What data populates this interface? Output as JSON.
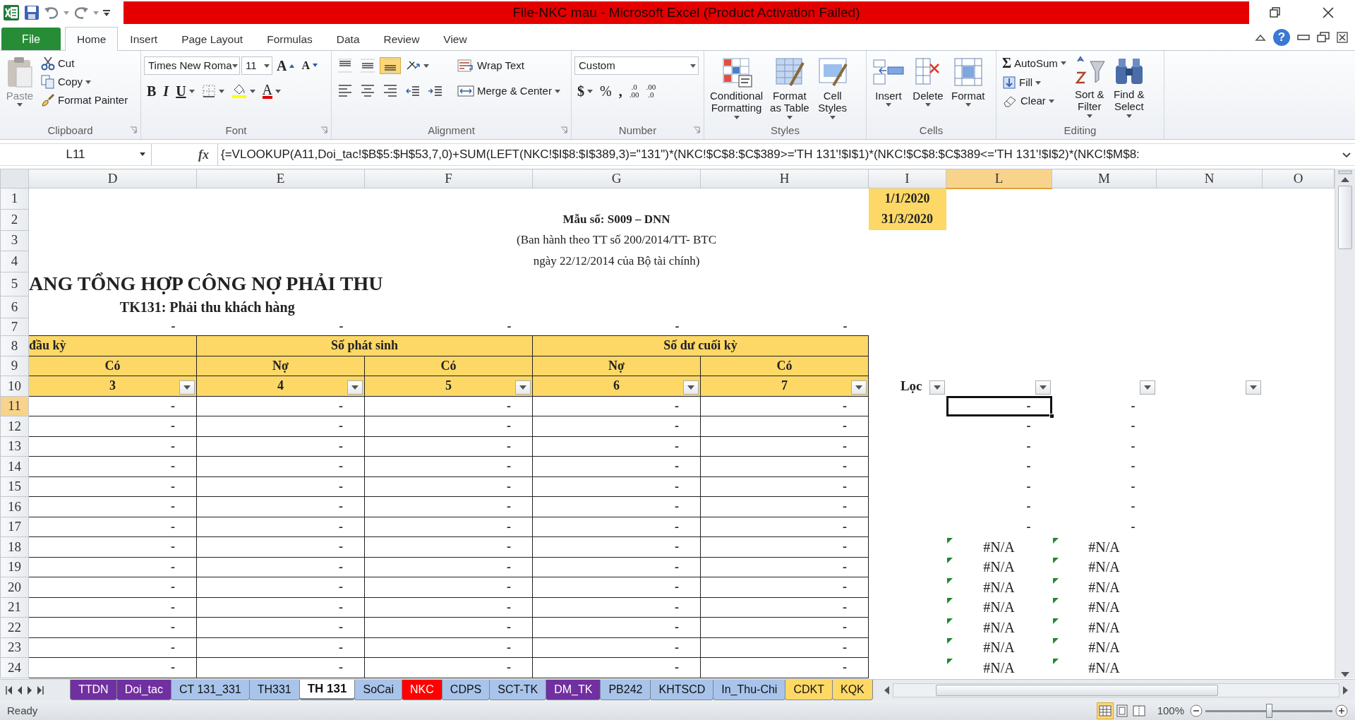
{
  "window": {
    "title": "File-NKC mau  -  Microsoft Excel (Product Activation Failed)",
    "help": "?"
  },
  "menu_tabs": [
    {
      "label": "File",
      "kind": "file",
      "selected": false
    },
    {
      "label": "Home",
      "kind": "tab",
      "selected": true
    },
    {
      "label": "Insert",
      "kind": "tab",
      "selected": false
    },
    {
      "label": "Page Layout",
      "kind": "tab",
      "selected": false
    },
    {
      "label": "Formulas",
      "kind": "tab",
      "selected": false
    },
    {
      "label": "Data",
      "kind": "tab",
      "selected": false
    },
    {
      "label": "Review",
      "kind": "tab",
      "selected": false
    },
    {
      "label": "View",
      "kind": "tab",
      "selected": false
    }
  ],
  "ribbon": {
    "clipboard": {
      "caption": "Clipboard",
      "paste": "Paste",
      "cut": "Cut",
      "copy": "Copy",
      "format_painter": "Format Painter"
    },
    "font": {
      "caption": "Font",
      "font_name": "Times New Roma",
      "font_size": "11",
      "grow": "A",
      "shrink": "A",
      "bold": "B",
      "italic": "I",
      "underline": "U",
      "font_color": "A"
    },
    "alignment": {
      "caption": "Alignment",
      "vertical": [
        {
          "selected": false
        },
        {
          "selected": false
        },
        {
          "selected": true
        }
      ],
      "wrap_text": "Wrap Text",
      "merge_center": "Merge & Center"
    },
    "number": {
      "caption": "Number",
      "format": "Custom",
      "currency": "$",
      "percent": "%",
      "comma": ",",
      "increase_decimal": [
        ".0",
        ".00"
      ],
      "decrease_decimal": [
        ".00",
        ".0"
      ]
    },
    "styles": {
      "caption": "Styles",
      "buttons": [
        {
          "lines": [
            "Conditional",
            "Formatting"
          ]
        },
        {
          "lines": [
            "Format",
            "as Table"
          ]
        },
        {
          "lines": [
            "Cell",
            "Styles"
          ]
        }
      ]
    },
    "cells": {
      "caption": "Cells",
      "buttons": [
        {
          "label": "Insert"
        },
        {
          "label": "Delete"
        },
        {
          "label": "Format"
        }
      ]
    },
    "editing": {
      "caption": "Editing",
      "sigma": "Σ",
      "autosum": "AutoSum",
      "fill": "Fill",
      "clear": "Clear",
      "buttons": [
        {
          "lines": [
            "Sort &",
            "Filter"
          ]
        },
        {
          "lines": [
            "Find &",
            "Select"
          ]
        }
      ]
    }
  },
  "formula_bar": {
    "name_box": "L11",
    "fx": "fx",
    "formula": "{=VLOOKUP(A11,Doi_tac!$B$5:$H$53,7,0)+SUM(LEFT(NKC!$I$8:$I$389,3)=\"131\")*(NKC!$C$8:$C$389>='TH 131'!$I$1)*(NKC!$C$8:$C$389<='TH 131'!$I$2)*(NKC!$M$8:"
  },
  "columns": [
    {
      "label": "D",
      "selected": false
    },
    {
      "label": "E",
      "selected": false
    },
    {
      "label": "F",
      "selected": false
    },
    {
      "label": "G",
      "selected": false
    },
    {
      "label": "H",
      "selected": false
    },
    {
      "label": "I",
      "selected": false
    },
    {
      "label": "L",
      "selected": true
    },
    {
      "label": "M",
      "selected": false
    },
    {
      "label": "N",
      "selected": false
    },
    {
      "label": "O",
      "selected": false
    }
  ],
  "rows": [
    {
      "label": "1",
      "selected": false,
      "cells": [
        {
          "kind": "blank"
        },
        {
          "kind": "blank"
        },
        {
          "kind": "blank"
        },
        {
          "kind": "blank"
        },
        {
          "kind": "blank"
        },
        {
          "kind": "date",
          "text": "1/1/2020"
        }
      ]
    },
    {
      "label": "2",
      "selected": false,
      "cells": [
        {
          "kind": "blank"
        },
        {
          "kind": "blank"
        },
        {
          "kind": "form_code",
          "text": "Mẫu số: S009 – DNN"
        },
        {
          "kind": "merged"
        },
        {
          "kind": "merged"
        },
        {
          "kind": "date",
          "text": "31/3/2020"
        }
      ]
    },
    {
      "label": "3",
      "selected": false,
      "cells": [
        {
          "kind": "blank"
        },
        {
          "kind": "blank"
        },
        {
          "kind": "note",
          "text": "(Ban hành theo TT số 200/2014/TT- BTC"
        },
        {
          "kind": "merged"
        },
        {
          "kind": "merged"
        }
      ]
    },
    {
      "label": "4",
      "selected": false,
      "cells": [
        {
          "kind": "blank"
        },
        {
          "kind": "blank"
        },
        {
          "kind": "note",
          "text": "ngày 22/12/2014 của Bộ tài chính)"
        },
        {
          "kind": "merged"
        },
        {
          "kind": "merged"
        }
      ]
    },
    {
      "label": "5",
      "selected": false,
      "cells": [
        {
          "kind": "title",
          "text": "ANG TỔNG HỢP CÔNG NỢ PHẢI THU"
        },
        {
          "kind": "merged"
        }
      ]
    },
    {
      "label": "6",
      "selected": false,
      "cells": [
        {
          "kind": "subtitle",
          "text": "TK131: Phải thu khách hàng"
        },
        {
          "kind": "merged"
        }
      ]
    },
    {
      "label": "7",
      "selected": false,
      "cells": [
        {
          "kind": "dash",
          "text": "-"
        },
        {
          "kind": "dash",
          "text": "-"
        },
        {
          "kind": "dash",
          "text": "-"
        },
        {
          "kind": "dash",
          "text": "-"
        },
        {
          "kind": "dash",
          "text": "-"
        }
      ]
    },
    {
      "label": "8",
      "selected": false,
      "cells": [
        {
          "kind": "header_cut",
          "text": "đầu kỳ"
        },
        {
          "kind": "header",
          "text": "Số phát sinh"
        },
        {
          "kind": "merged"
        },
        {
          "kind": "header",
          "text": "Số dư cuối kỳ"
        },
        {
          "kind": "merged"
        }
      ]
    },
    {
      "label": "9",
      "selected": false,
      "cells": [
        {
          "kind": "header",
          "text": "Có"
        },
        {
          "kind": "header",
          "text": "Nợ"
        },
        {
          "kind": "header",
          "text": "Có"
        },
        {
          "kind": "header",
          "text": "Nợ"
        },
        {
          "kind": "header",
          "text": "Có"
        }
      ]
    },
    {
      "label": "10",
      "selected": false,
      "cells": [
        {
          "kind": "header",
          "text": "3",
          "filter": true
        },
        {
          "kind": "header",
          "text": "4",
          "filter": true
        },
        {
          "kind": "header",
          "text": "5",
          "filter": true
        },
        {
          "kind": "header",
          "text": "6",
          "filter": true
        },
        {
          "kind": "header",
          "text": "7",
          "filter": true
        },
        {
          "kind": "filter_label",
          "text": "Lọc",
          "filter": true
        },
        {
          "kind": "blank",
          "filter": true
        },
        {
          "kind": "blank",
          "filter": true
        },
        {
          "kind": "blank",
          "filter": true
        }
      ]
    },
    {
      "label": "11",
      "selected": true,
      "cells": [
        {
          "kind": "value",
          "text": "-"
        },
        {
          "kind": "value",
          "text": "-"
        },
        {
          "kind": "value",
          "text": "-"
        },
        {
          "kind": "value",
          "text": "-"
        },
        {
          "kind": "value",
          "text": "-"
        },
        {
          "kind": "blank"
        },
        {
          "kind": "dash",
          "text": "-",
          "selected": true
        },
        {
          "kind": "dash",
          "text": "-"
        }
      ]
    },
    {
      "label": "12",
      "selected": false,
      "cells": [
        {
          "kind": "value",
          "text": "-"
        },
        {
          "kind": "value",
          "text": "-"
        },
        {
          "kind": "value",
          "text": "-"
        },
        {
          "kind": "value",
          "text": "-"
        },
        {
          "kind": "value",
          "text": "-"
        },
        {
          "kind": "blank"
        },
        {
          "kind": "dash",
          "text": "-"
        },
        {
          "kind": "dash",
          "text": "-"
        }
      ]
    },
    {
      "label": "13",
      "selected": false,
      "cells": [
        {
          "kind": "value",
          "text": "-"
        },
        {
          "kind": "value",
          "text": "-"
        },
        {
          "kind": "value",
          "text": "-"
        },
        {
          "kind": "value",
          "text": "-"
        },
        {
          "kind": "value",
          "text": "-"
        },
        {
          "kind": "blank"
        },
        {
          "kind": "dash",
          "text": "-"
        },
        {
          "kind": "dash",
          "text": "-"
        }
      ]
    },
    {
      "label": "14",
      "selected": false,
      "cells": [
        {
          "kind": "value",
          "text": "-"
        },
        {
          "kind": "value",
          "text": "-"
        },
        {
          "kind": "value",
          "text": "-"
        },
        {
          "kind": "value",
          "text": "-"
        },
        {
          "kind": "value",
          "text": "-"
        },
        {
          "kind": "blank"
        },
        {
          "kind": "dash",
          "text": "-"
        },
        {
          "kind": "dash",
          "text": "-"
        }
      ]
    },
    {
      "label": "15",
      "selected": false,
      "cells": [
        {
          "kind": "value",
          "text": "-"
        },
        {
          "kind": "value",
          "text": "-"
        },
        {
          "kind": "value",
          "text": "-"
        },
        {
          "kind": "value",
          "text": "-"
        },
        {
          "kind": "value",
          "text": "-"
        },
        {
          "kind": "blank"
        },
        {
          "kind": "dash",
          "text": "-"
        },
        {
          "kind": "dash",
          "text": "-"
        }
      ]
    },
    {
      "label": "16",
      "selected": false,
      "cells": [
        {
          "kind": "value",
          "text": "-"
        },
        {
          "kind": "value",
          "text": "-"
        },
        {
          "kind": "value",
          "text": "-"
        },
        {
          "kind": "value",
          "text": "-"
        },
        {
          "kind": "value",
          "text": "-"
        },
        {
          "kind": "blank"
        },
        {
          "kind": "dash",
          "text": "-"
        },
        {
          "kind": "dash",
          "text": "-"
        }
      ]
    },
    {
      "label": "17",
      "selected": false,
      "cells": [
        {
          "kind": "value",
          "text": "-"
        },
        {
          "kind": "value",
          "text": "-"
        },
        {
          "kind": "value",
          "text": "-"
        },
        {
          "kind": "value",
          "text": "-"
        },
        {
          "kind": "value",
          "text": "-"
        },
        {
          "kind": "blank"
        },
        {
          "kind": "dash",
          "text": "-"
        },
        {
          "kind": "dash",
          "text": "-"
        }
      ]
    },
    {
      "label": "18",
      "selected": false,
      "cells": [
        {
          "kind": "value",
          "text": "-"
        },
        {
          "kind": "value",
          "text": "-"
        },
        {
          "kind": "value",
          "text": "-"
        },
        {
          "kind": "value",
          "text": "-"
        },
        {
          "kind": "value",
          "text": "-"
        },
        {
          "kind": "blank"
        },
        {
          "kind": "error",
          "text": "#N/A"
        },
        {
          "kind": "error",
          "text": "#N/A"
        }
      ]
    },
    {
      "label": "19",
      "selected": false,
      "cells": [
        {
          "kind": "value",
          "text": "-"
        },
        {
          "kind": "value",
          "text": "-"
        },
        {
          "kind": "value",
          "text": "-"
        },
        {
          "kind": "value",
          "text": "-"
        },
        {
          "kind": "value",
          "text": "-"
        },
        {
          "kind": "blank"
        },
        {
          "kind": "error",
          "text": "#N/A"
        },
        {
          "kind": "error",
          "text": "#N/A"
        }
      ]
    },
    {
      "label": "20",
      "selected": false,
      "cells": [
        {
          "kind": "value",
          "text": "-"
        },
        {
          "kind": "value",
          "text": "-"
        },
        {
          "kind": "value",
          "text": "-"
        },
        {
          "kind": "value",
          "text": "-"
        },
        {
          "kind": "value",
          "text": "-"
        },
        {
          "kind": "blank"
        },
        {
          "kind": "error",
          "text": "#N/A"
        },
        {
          "kind": "error",
          "text": "#N/A"
        }
      ]
    },
    {
      "label": "21",
      "selected": false,
      "cells": [
        {
          "kind": "value",
          "text": "-"
        },
        {
          "kind": "value",
          "text": "-"
        },
        {
          "kind": "value",
          "text": "-"
        },
        {
          "kind": "value",
          "text": "-"
        },
        {
          "kind": "value",
          "text": "-"
        },
        {
          "kind": "blank"
        },
        {
          "kind": "error",
          "text": "#N/A"
        },
        {
          "kind": "error",
          "text": "#N/A"
        }
      ]
    },
    {
      "label": "22",
      "selected": false,
      "cells": [
        {
          "kind": "value",
          "text": "-"
        },
        {
          "kind": "value",
          "text": "-"
        },
        {
          "kind": "value",
          "text": "-"
        },
        {
          "kind": "value",
          "text": "-"
        },
        {
          "kind": "value",
          "text": "-"
        },
        {
          "kind": "blank"
        },
        {
          "kind": "error",
          "text": "#N/A"
        },
        {
          "kind": "error",
          "text": "#N/A"
        }
      ]
    },
    {
      "label": "23",
      "selected": false,
      "cells": [
        {
          "kind": "value",
          "text": "-"
        },
        {
          "kind": "value",
          "text": "-"
        },
        {
          "kind": "value",
          "text": "-"
        },
        {
          "kind": "value",
          "text": "-"
        },
        {
          "kind": "value",
          "text": "-"
        },
        {
          "kind": "blank"
        },
        {
          "kind": "error",
          "text": "#N/A"
        },
        {
          "kind": "error",
          "text": "#N/A"
        }
      ]
    },
    {
      "label": "24",
      "selected": false,
      "cells": [
        {
          "kind": "value",
          "text": "-"
        },
        {
          "kind": "value",
          "text": "-"
        },
        {
          "kind": "value",
          "text": "-"
        },
        {
          "kind": "value",
          "text": "-"
        },
        {
          "kind": "value",
          "text": "-"
        },
        {
          "kind": "blank"
        },
        {
          "kind": "error",
          "text": "#N/A"
        },
        {
          "kind": "error",
          "text": "#N/A"
        }
      ]
    }
  ],
  "sheet_tabs": [
    {
      "label": "TTDN",
      "color": "#7030a0",
      "selected": false
    },
    {
      "label": "Doi_tac",
      "color": "#7030a0",
      "selected": false
    },
    {
      "label": "CT 131_331",
      "color": "#a9c4eb",
      "selected": false
    },
    {
      "label": "TH331",
      "color": "#a9c4eb",
      "selected": false
    },
    {
      "label": "TH 131",
      "color": "#ffffff",
      "selected": true
    },
    {
      "label": "SoCai",
      "color": "#a9c4eb",
      "selected": false
    },
    {
      "label": "NKC",
      "color": "#ff0000",
      "selected": false
    },
    {
      "label": "CDPS",
      "color": "#a9c4eb",
      "selected": false
    },
    {
      "label": "SCT-TK",
      "color": "#a9c4eb",
      "selected": false
    },
    {
      "label": "DM_TK",
      "color": "#7030a0",
      "selected": false
    },
    {
      "label": "PB242",
      "color": "#a9c4eb",
      "selected": false
    },
    {
      "label": "KHTSCD",
      "color": "#a9c4eb",
      "selected": false
    },
    {
      "label": "In_Thu-Chi",
      "color": "#a9c4eb",
      "selected": false
    },
    {
      "label": "CDKT",
      "color": "#ffd966",
      "selected": false
    },
    {
      "label": "KQK",
      "color": "#ffd966",
      "selected": false
    }
  ],
  "status_bar": {
    "text": "Ready",
    "views": [
      {
        "selected": true
      },
      {
        "selected": false
      },
      {
        "selected": false
      }
    ],
    "zoom": "100%",
    "zoom_slider": {
      "level": 0.5
    }
  }
}
